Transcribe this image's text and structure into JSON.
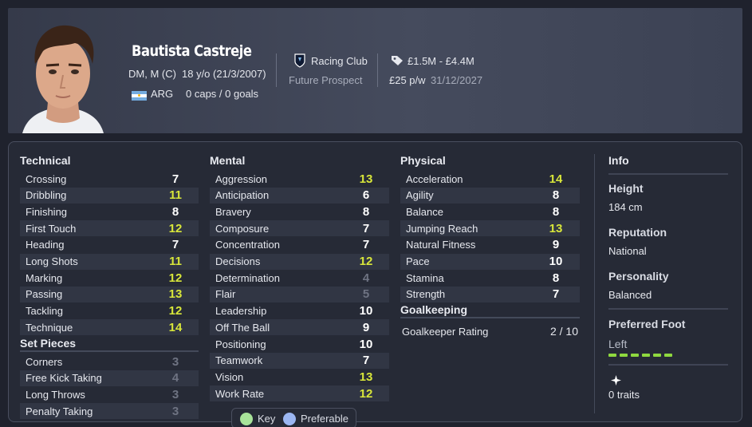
{
  "player": {
    "name": "Bautista Castreje",
    "positions": "DM, M (C)",
    "age_dob": "18 y/o (21/3/2007)",
    "nationality": "ARG",
    "caps_goals": "0 caps / 0 goals",
    "club": "Racing Club",
    "status": "Future Prospect",
    "value": "£1.5M - £4.4M",
    "wage": "£25 p/w",
    "contract_end": "31/12/2027"
  },
  "technical": {
    "title": "Technical",
    "attributes": [
      {
        "name": "Crossing",
        "value": "7",
        "tone": "white"
      },
      {
        "name": "Dribbling",
        "value": "11",
        "tone": "green"
      },
      {
        "name": "Finishing",
        "value": "8",
        "tone": "white"
      },
      {
        "name": "First Touch",
        "value": "12",
        "tone": "green"
      },
      {
        "name": "Heading",
        "value": "7",
        "tone": "white"
      },
      {
        "name": "Long Shots",
        "value": "11",
        "tone": "green"
      },
      {
        "name": "Marking",
        "value": "12",
        "tone": "green"
      },
      {
        "name": "Passing",
        "value": "13",
        "tone": "green"
      },
      {
        "name": "Tackling",
        "value": "12",
        "tone": "green"
      },
      {
        "name": "Technique",
        "value": "14",
        "tone": "green"
      }
    ]
  },
  "set_pieces": {
    "title": "Set Pieces",
    "attributes": [
      {
        "name": "Corners",
        "value": "3",
        "tone": "grey"
      },
      {
        "name": "Free Kick Taking",
        "value": "4",
        "tone": "grey"
      },
      {
        "name": "Long Throws",
        "value": "3",
        "tone": "grey"
      },
      {
        "name": "Penalty Taking",
        "value": "3",
        "tone": "grey"
      }
    ]
  },
  "mental": {
    "title": "Mental",
    "attributes": [
      {
        "name": "Aggression",
        "value": "13",
        "tone": "green"
      },
      {
        "name": "Anticipation",
        "value": "6",
        "tone": "white"
      },
      {
        "name": "Bravery",
        "value": "8",
        "tone": "white"
      },
      {
        "name": "Composure",
        "value": "7",
        "tone": "white"
      },
      {
        "name": "Concentration",
        "value": "7",
        "tone": "white"
      },
      {
        "name": "Decisions",
        "value": "12",
        "tone": "green"
      },
      {
        "name": "Determination",
        "value": "4",
        "tone": "grey"
      },
      {
        "name": "Flair",
        "value": "5",
        "tone": "grey"
      },
      {
        "name": "Leadership",
        "value": "10",
        "tone": "white"
      },
      {
        "name": "Off The Ball",
        "value": "9",
        "tone": "white"
      },
      {
        "name": "Positioning",
        "value": "10",
        "tone": "white"
      },
      {
        "name": "Teamwork",
        "value": "7",
        "tone": "white"
      },
      {
        "name": "Vision",
        "value": "13",
        "tone": "green"
      },
      {
        "name": "Work Rate",
        "value": "12",
        "tone": "green"
      }
    ]
  },
  "physical": {
    "title": "Physical",
    "attributes": [
      {
        "name": "Acceleration",
        "value": "14",
        "tone": "green"
      },
      {
        "name": "Agility",
        "value": "8",
        "tone": "white"
      },
      {
        "name": "Balance",
        "value": "8",
        "tone": "white"
      },
      {
        "name": "Jumping Reach",
        "value": "13",
        "tone": "green"
      },
      {
        "name": "Natural Fitness",
        "value": "9",
        "tone": "white"
      },
      {
        "name": "Pace",
        "value": "10",
        "tone": "white"
      },
      {
        "name": "Stamina",
        "value": "8",
        "tone": "white"
      },
      {
        "name": "Strength",
        "value": "7",
        "tone": "white"
      }
    ]
  },
  "goalkeeping": {
    "title": "Goalkeeping",
    "rating_label": "Goalkeeper Rating",
    "rating_value": "2 / 10"
  },
  "info": {
    "title": "Info",
    "height_label": "Height",
    "height_value": "184 cm",
    "reputation_label": "Reputation",
    "reputation_value": "National",
    "personality_label": "Personality",
    "personality_value": "Balanced",
    "foot_label": "Preferred Foot",
    "foot_value": "Left",
    "foot_strength": 6,
    "traits_value": "0 traits"
  },
  "legend": {
    "key_label": "Key",
    "preferable_label": "Preferable",
    "key_color": "#a8e39a",
    "preferable_color": "#9bb6f2"
  },
  "colors": {
    "green_value": "#d8e63a",
    "white_value": "#ffffff",
    "grey_value": "#6e7382",
    "foot_bar": "#8fd93f"
  },
  "icons": {
    "club_badge": "racing-club-badge-icon",
    "value_tag": "price-tag-icon",
    "flag": "argentina-flag-icon",
    "traits": "sparkle-icon"
  }
}
